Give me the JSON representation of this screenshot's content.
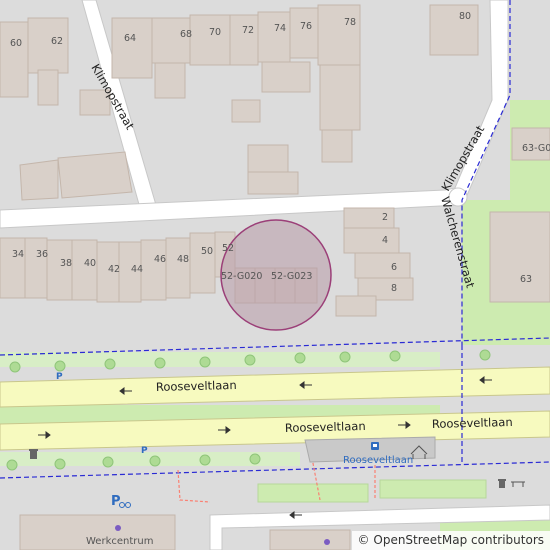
{
  "map": {
    "streets": {
      "klimopstraat": "Klimopstraat",
      "walcherenstraat": "Walcherenstraat",
      "rooseveltlaan": "Rooseveltlaan"
    },
    "house_numbers": [
      "60",
      "62",
      "64",
      "68",
      "70",
      "72",
      "74",
      "76",
      "78",
      "80",
      "34",
      "36",
      "38",
      "40",
      "42",
      "44",
      "46",
      "48",
      "50",
      "52",
      "2",
      "4",
      "6",
      "8",
      "63",
      "63-G0"
    ],
    "unit_labels": [
      "52-G020",
      "52-G023"
    ],
    "pois": {
      "bus_stop": "Rooseveltlaan",
      "werkcentrum": "Werkcentrum"
    },
    "colors": {
      "background": "#dcdcdc",
      "building": "#d9d0c9",
      "building_stroke": "#c4b6ab",
      "main_road": "#f7fabf",
      "grass": "#cdebb0",
      "highlight_fill": "#b89aa8",
      "highlight_stroke": "#9b3f78",
      "cycleway": "#2a2ad4",
      "footway": "#fa8072"
    },
    "icons": [
      "parking-icon",
      "bicycle-parking-icon",
      "bus-stop-icon",
      "waste-basket-icon",
      "shelter-icon",
      "bench-icon"
    ]
  },
  "attribution": {
    "symbol": "©",
    "text": "OpenStreetMap contributors"
  }
}
